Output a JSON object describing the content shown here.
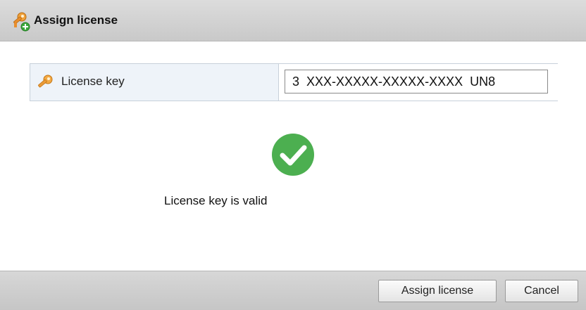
{
  "dialog": {
    "title": "Assign license",
    "title_icon": "key-plus-icon"
  },
  "license": {
    "label": "License key",
    "label_icon": "key-icon",
    "value": "3  XXX-XXXXX-XXXXX-XXXX  UN8"
  },
  "validation": {
    "icon": "check-circle-icon",
    "message": "License key is valid",
    "color": "#4caf50"
  },
  "footer": {
    "assign_label": "Assign license",
    "cancel_label": "Cancel"
  }
}
